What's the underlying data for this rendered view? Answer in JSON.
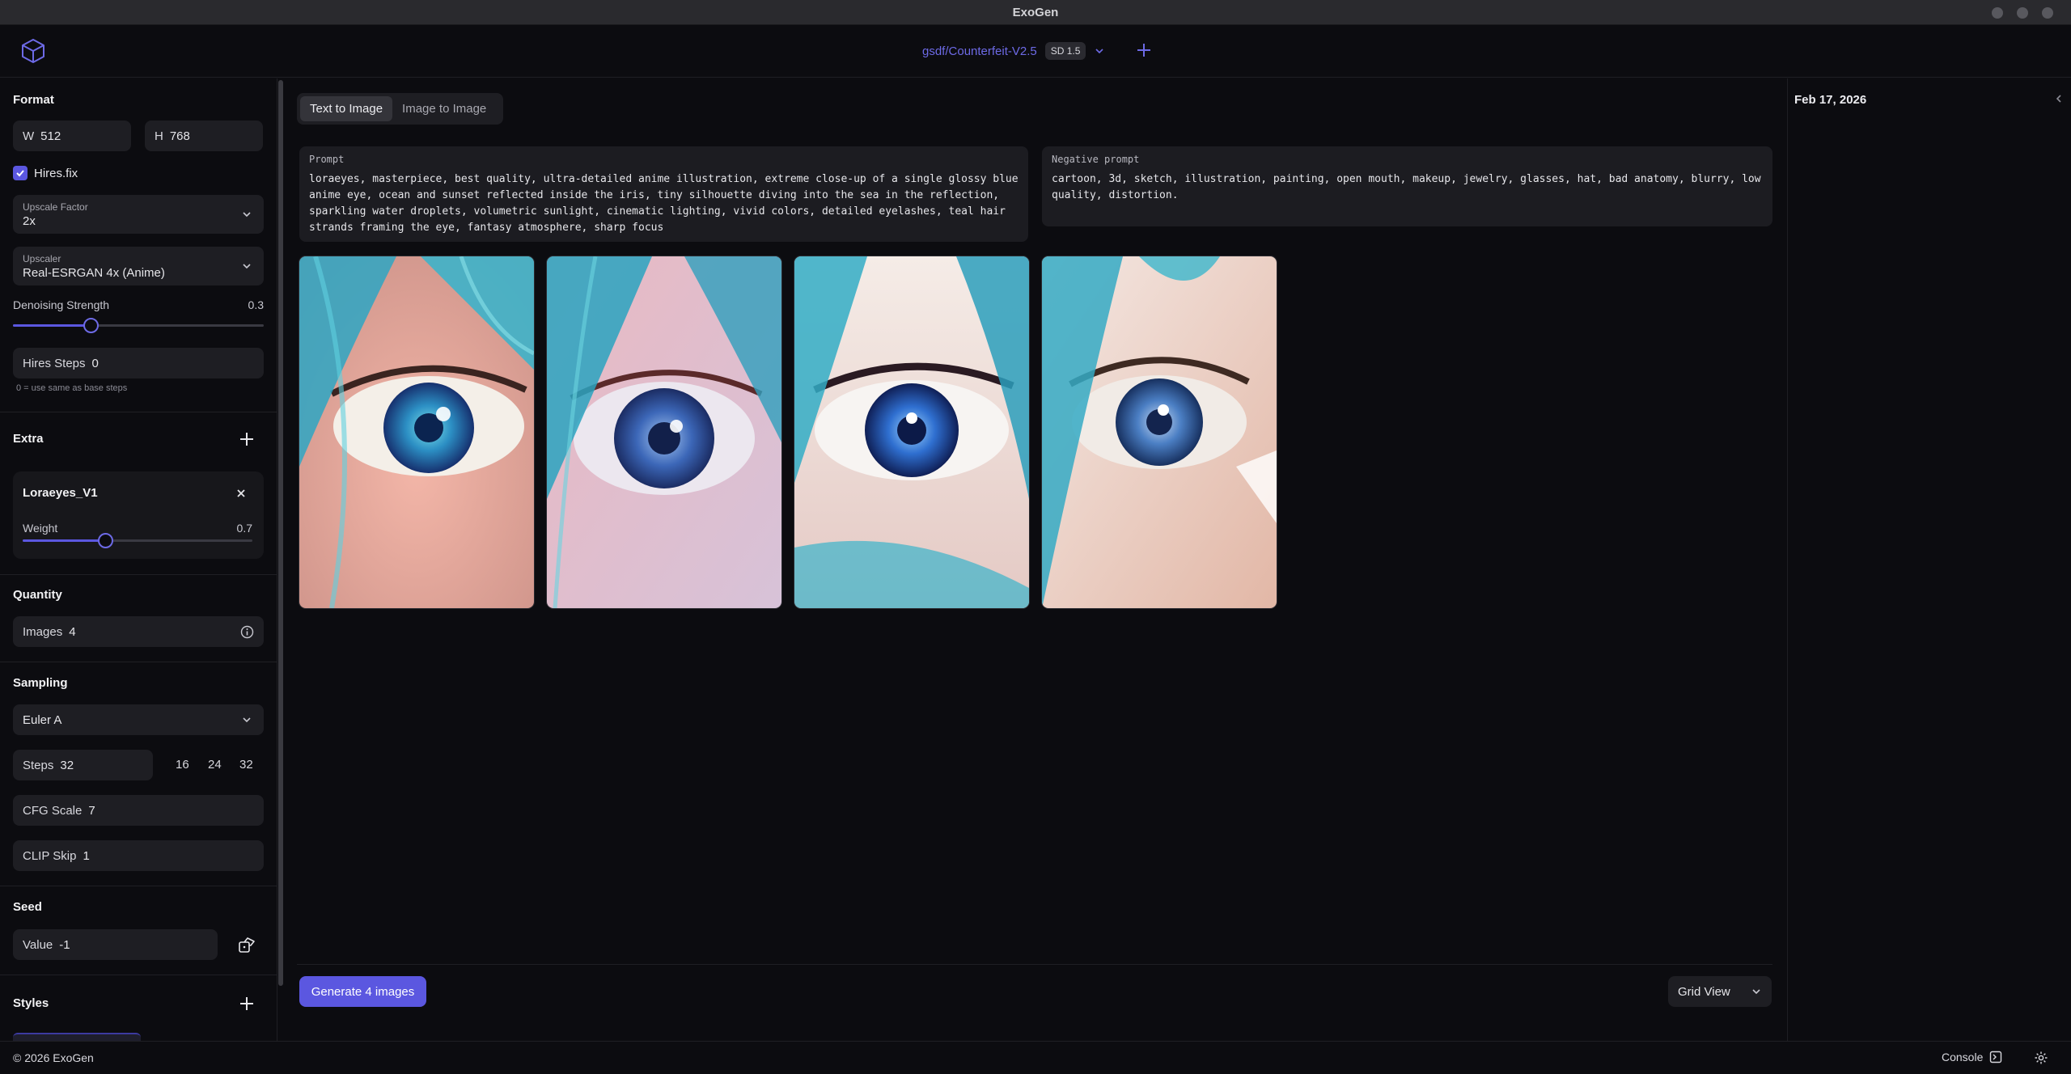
{
  "app": {
    "title": "ExoGen"
  },
  "header": {
    "model_name": "gsdf/Counterfeit-V2.5",
    "model_badge": "SD 1.5"
  },
  "sidebar": {
    "format": {
      "title": "Format",
      "width_label": "W",
      "width_value": "512",
      "height_label": "H",
      "height_value": "768",
      "hires_label": "Hires.fix",
      "hires_checked": true,
      "upscale_factor_label": "Upscale Factor",
      "upscale_factor_value": "2x",
      "upscaler_label": "Upscaler",
      "upscaler_value": "Real-ESRGAN 4x (Anime)",
      "denoising_label": "Denoising Strength",
      "denoising_value": "0.3",
      "hires_steps_label": "Hires Steps",
      "hires_steps_value": "0",
      "hires_steps_hint": "0 = use same as base steps"
    },
    "extra": {
      "title": "Extra",
      "lora_name": "Loraeyes_V1",
      "weight_label": "Weight",
      "weight_value": "0.7"
    },
    "quantity": {
      "title": "Quantity",
      "images_label": "Images",
      "images_value": "4"
    },
    "sampling": {
      "title": "Sampling",
      "sampler_value": "Euler A",
      "steps_label": "Steps",
      "steps_value": "32",
      "step_presets": [
        "16",
        "24",
        "32"
      ],
      "cfg_label": "CFG Scale",
      "cfg_value": "7",
      "clip_label": "CLIP Skip",
      "clip_value": "1"
    },
    "seed": {
      "title": "Seed",
      "value_label": "Value",
      "value": "-1"
    },
    "styles": {
      "title": "Styles"
    }
  },
  "main": {
    "tabs": [
      {
        "label": "Text to Image",
        "active": true
      },
      {
        "label": "Image to Image",
        "active": false
      }
    ],
    "prompt_label": "Prompt",
    "prompt_text": "loraeyes, masterpiece, best quality, ultra-detailed anime illustration, extreme close-up of a single glossy blue anime eye, ocean and sunset reflected inside the iris, tiny silhouette diving into the sea in the reflection, sparkling water droplets, volumetric sunlight, cinematic lighting, vivid colors, detailed eyelashes, teal hair strands framing the eye, fantasy atmosphere, sharp focus",
    "negative_label": "Negative prompt",
    "negative_text": "cartoon, 3d, sketch, illustration, painting, open mouth, makeup, jewelry, glasses, hat, bad anatomy, blurry, low quality, distortion.",
    "generate_label": "Generate 4 images",
    "view_label": "Grid View"
  },
  "right_panel": {
    "date": "Feb 17, 2026"
  },
  "footer": {
    "copyright": "© 2026 ExoGen",
    "console_label": "Console"
  },
  "colors": {
    "accent": "#5b57e0",
    "background": "#0c0c10",
    "field": "#1e1e23"
  },
  "images": [
    {
      "alt": "generated-image-1"
    },
    {
      "alt": "generated-image-2"
    },
    {
      "alt": "generated-image-3"
    },
    {
      "alt": "generated-image-4"
    }
  ]
}
